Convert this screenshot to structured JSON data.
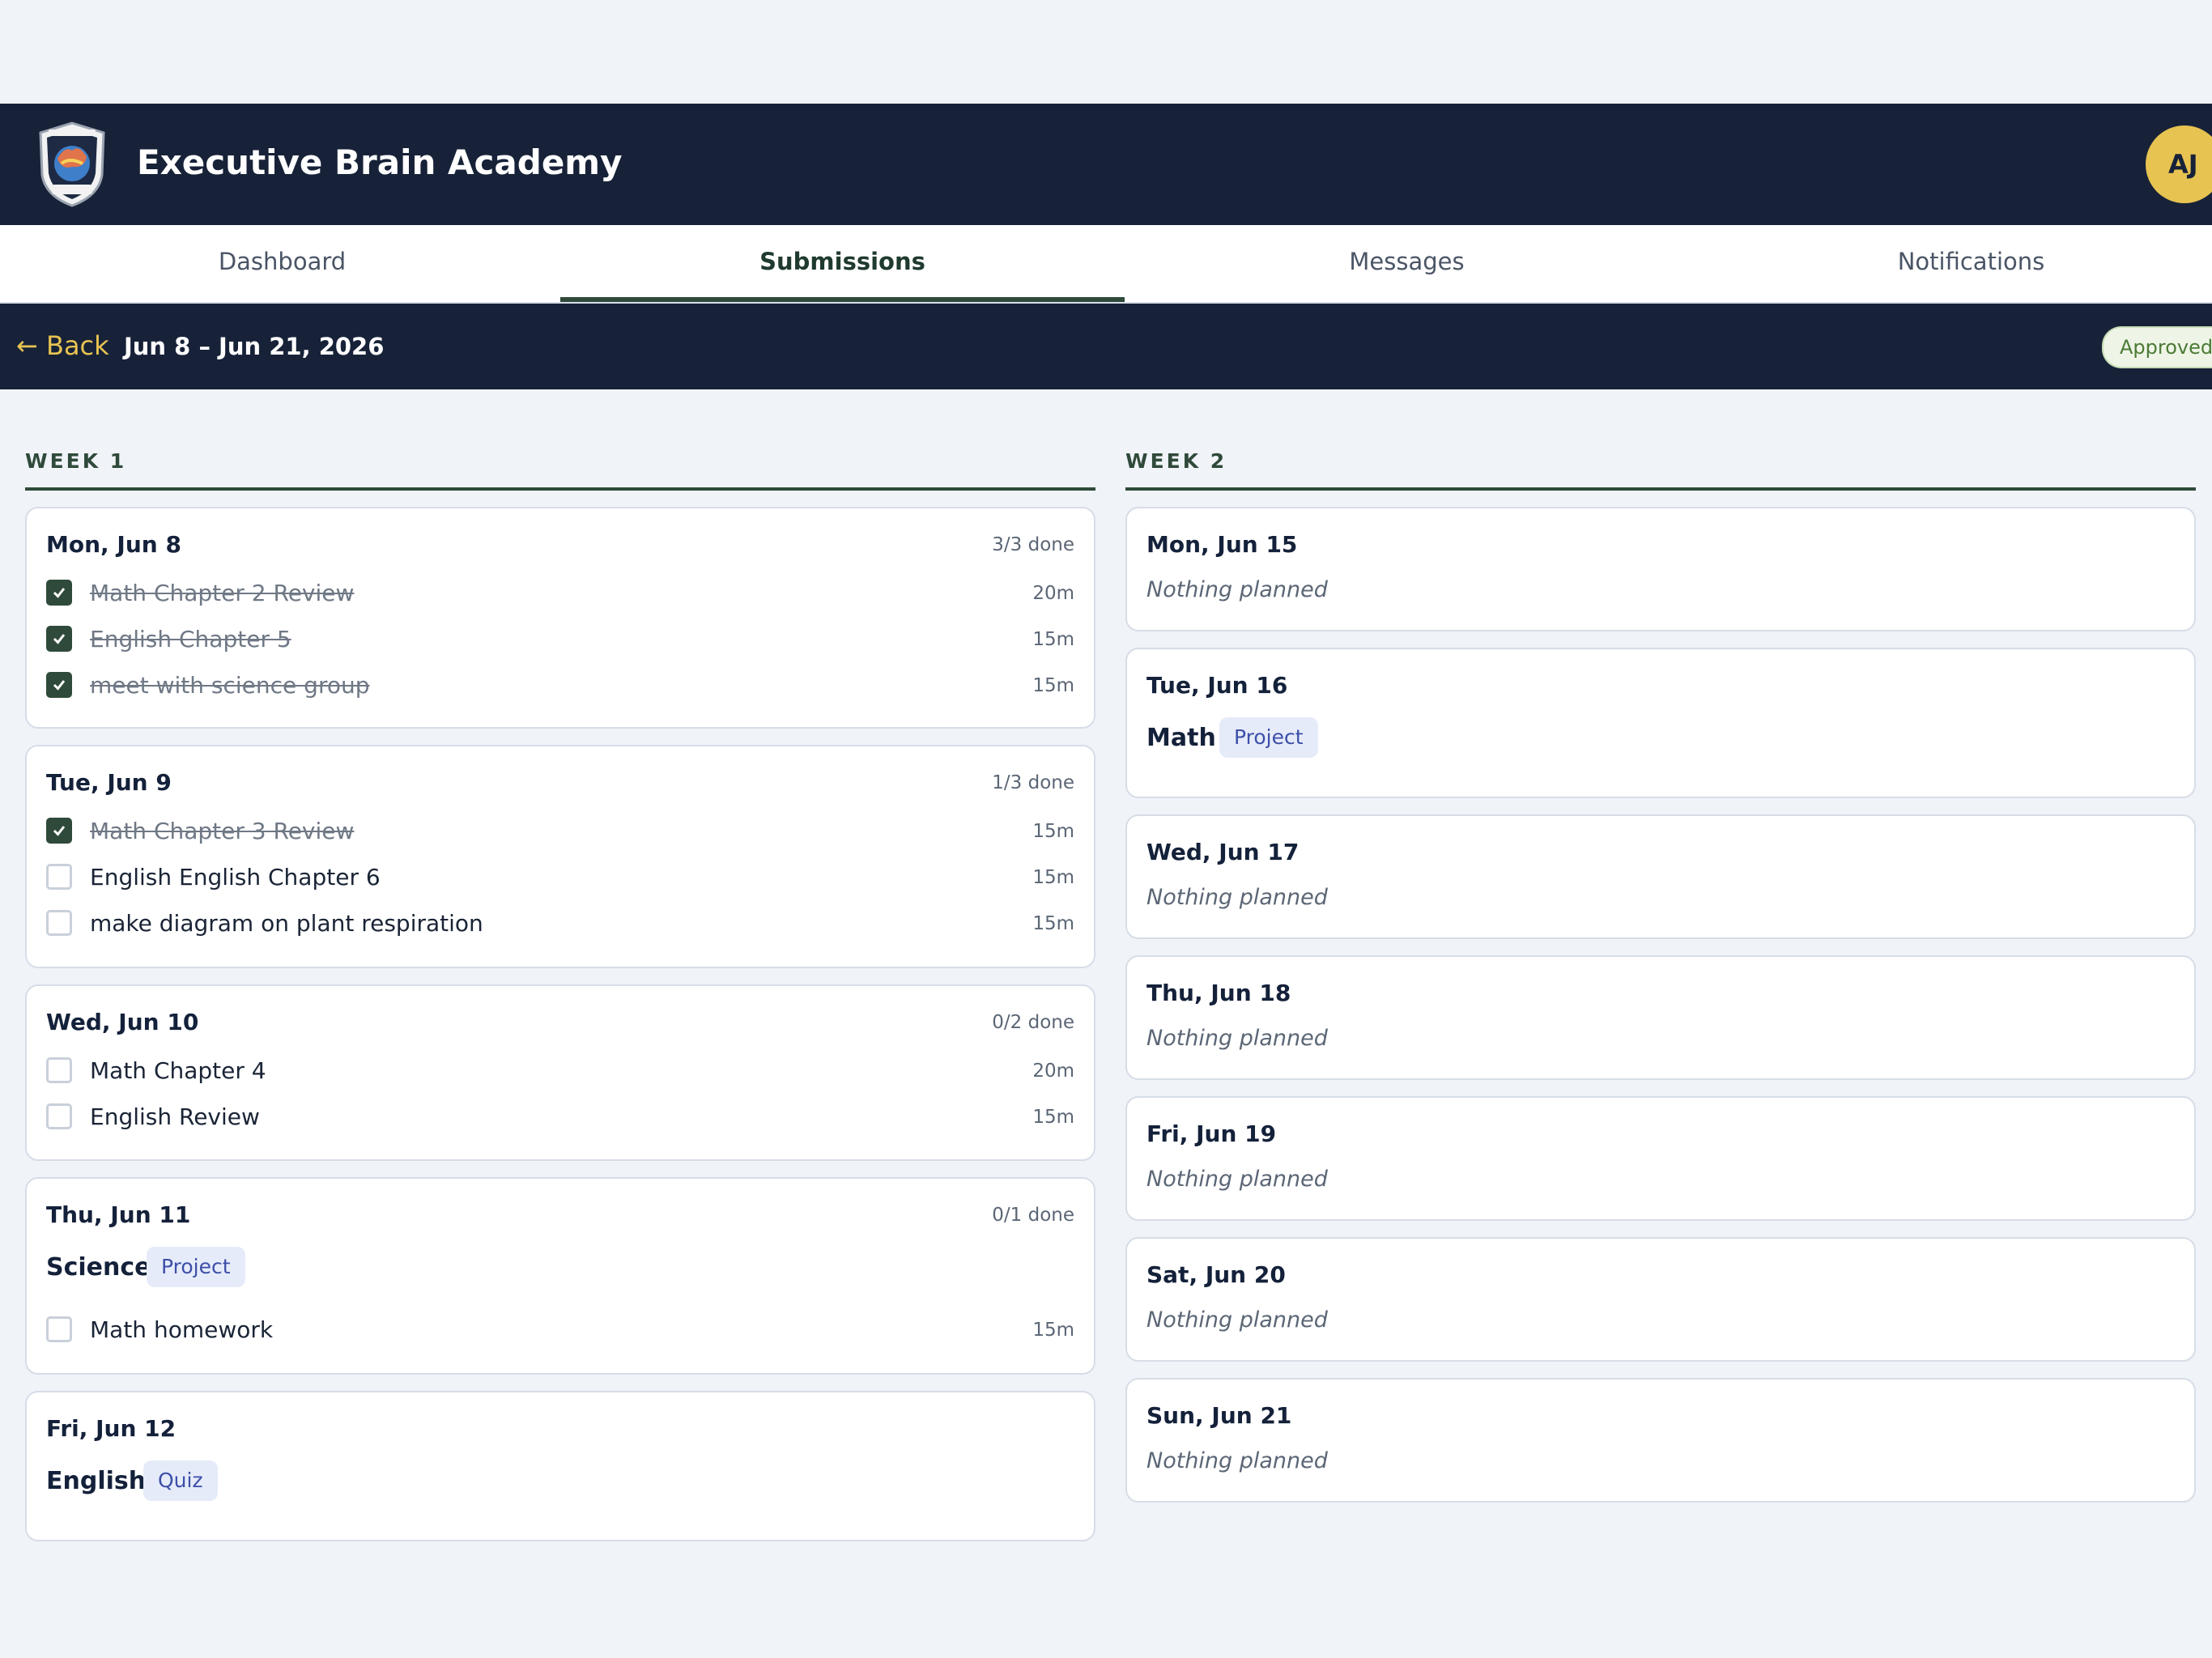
{
  "header": {
    "app_title": "Executive Brain Academy",
    "avatar_initials": "AJ",
    "colors": {
      "navy": "#172238",
      "gold": "#e7c352",
      "green": "#2f4a3a"
    }
  },
  "tabs": [
    {
      "label": "Dashboard",
      "active": false
    },
    {
      "label": "Submissions",
      "active": true
    },
    {
      "label": "Messages",
      "active": false
    },
    {
      "label": "Notifications",
      "active": false
    }
  ],
  "subbar": {
    "back_label": "← Back",
    "date_range": "Jun 8 – Jun 21, 2026",
    "status": "Approved"
  },
  "weeks": [
    {
      "label": "WEEK 1",
      "days": [
        {
          "date": "Mon, Jun 8",
          "done": "3/3 done",
          "tasks": [
            {
              "label": "Math Chapter 2 Review",
              "duration": "20m",
              "done": true
            },
            {
              "label": "English Chapter 5",
              "duration": "15m",
              "done": true
            },
            {
              "label": "meet with science group",
              "duration": "15m",
              "done": true
            }
          ]
        },
        {
          "date": "Tue, Jun 9",
          "done": "1/3 done",
          "tasks": [
            {
              "label": "Math Chapter 3 Review",
              "duration": "15m",
              "done": true
            },
            {
              "label": "English English Chapter 6",
              "duration": "15m",
              "done": false
            },
            {
              "label": "make diagram on plant respiration",
              "duration": "15m",
              "done": false
            }
          ]
        },
        {
          "date": "Wed, Jun 10",
          "done": "0/2 done",
          "tasks": [
            {
              "label": "Math Chapter 4",
              "duration": "20m",
              "done": false
            },
            {
              "label": "English Review",
              "duration": "15m",
              "done": false
            }
          ]
        },
        {
          "date": "Thu, Jun 11",
          "done": "0/1 done",
          "subject": {
            "name": "Science",
            "type": "Project"
          },
          "tasks": [
            {
              "label": "Math homework",
              "duration": "15m",
              "done": false
            }
          ]
        },
        {
          "date": "Fri, Jun 12",
          "subject": {
            "name": "English",
            "type": "Quiz"
          }
        }
      ]
    },
    {
      "label": "WEEK 2",
      "days": [
        {
          "date": "Mon, Jun 15",
          "empty_text": "Nothing planned"
        },
        {
          "date": "Tue, Jun 16",
          "subject": {
            "name": "Math",
            "type": "Project"
          }
        },
        {
          "date": "Wed, Jun 17",
          "empty_text": "Nothing planned"
        },
        {
          "date": "Thu, Jun 18",
          "empty_text": "Nothing planned"
        },
        {
          "date": "Fri, Jun 19",
          "empty_text": "Nothing planned"
        },
        {
          "date": "Sat, Jun 20",
          "empty_text": "Nothing planned"
        },
        {
          "date": "Sun, Jun 21",
          "empty_text": "Nothing planned"
        }
      ]
    }
  ]
}
